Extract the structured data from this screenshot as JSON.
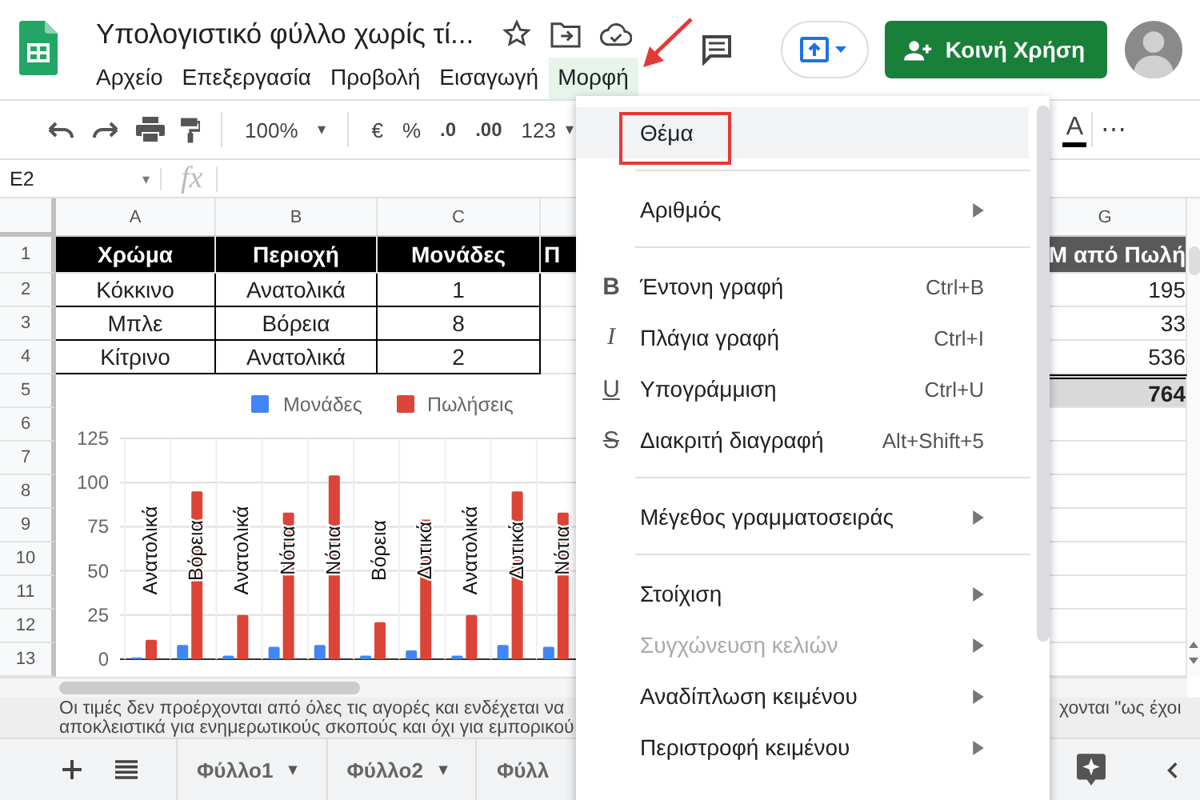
{
  "app": {
    "title": "Υπολογιστικό φύλλο χωρίς τί...",
    "share_button": "Κοινή Χρήση"
  },
  "menus": [
    {
      "label": "Αρχείο",
      "selected": false
    },
    {
      "label": "Επεξεργασία",
      "selected": false
    },
    {
      "label": "Προβολή",
      "selected": false
    },
    {
      "label": "Εισαγωγή",
      "selected": false
    },
    {
      "label": "Μορφή",
      "selected": true
    }
  ],
  "toolbar": {
    "zoom": "100%",
    "zoom_caret": "▾",
    "items": [
      {
        "label": "€",
        "kind": "plain"
      },
      {
        "label": "%",
        "kind": "plain"
      },
      {
        "label": ".0",
        "kind": "decimal"
      },
      {
        "label": ".00",
        "kind": "decimal"
      },
      {
        "label": "123",
        "kind": "dropdown",
        "caret": "▾"
      }
    ],
    "text_color": "A",
    "more": "⋯"
  },
  "formula_bar": {
    "cell_ref": "E2",
    "caret": "▾",
    "fx": "fx"
  },
  "sheet": {
    "columns": [
      "A",
      "B",
      "C",
      "G"
    ],
    "rows": [
      {
        "number": "1",
        "kind": "header",
        "cells": [
          "Χρώμα",
          "Περιοχή",
          "Μονάδες",
          "Π"
        ],
        "g": "M από Πωλή"
      },
      {
        "number": "2",
        "kind": "data",
        "cells": [
          "Κόκκινο",
          "Ανατολικά",
          "1"
        ],
        "g": "195"
      },
      {
        "number": "3",
        "kind": "data",
        "cells": [
          "Μπλε",
          "Βόρεια",
          "8"
        ],
        "g": "33"
      },
      {
        "number": "4",
        "kind": "data",
        "cells": [
          "Κίτρινο",
          "Ανατολικά",
          "2"
        ],
        "g": "536"
      },
      {
        "number": "5",
        "kind": "total",
        "g": "764"
      },
      {
        "number": "6",
        "kind": "blank"
      },
      {
        "number": "7",
        "kind": "blank"
      },
      {
        "number": "8",
        "kind": "blank"
      },
      {
        "number": "9",
        "kind": "blank"
      },
      {
        "number": "10",
        "kind": "blank"
      },
      {
        "number": "11",
        "kind": "blank"
      },
      {
        "number": "12",
        "kind": "blank"
      },
      {
        "number": "13",
        "kind": "blank"
      }
    ]
  },
  "chart": {
    "chart_data": {
      "type": "bar",
      "categories": [
        "Ανατολικά",
        "Βόρεια",
        "Ανατολικά",
        "Νότια",
        "Νότια",
        "Βόρεια",
        "Δυτικά",
        "Ανατολικά",
        "Δυτικά",
        "Νότια"
      ],
      "series": [
        {
          "name": "Μονάδες",
          "color": "#4285f4",
          "values": [
            1,
            8,
            2,
            7,
            8,
            2,
            5,
            2,
            8,
            7
          ]
        },
        {
          "name": "Πωλήσεις",
          "color": "#db4437",
          "values": [
            11,
            95,
            25,
            83,
            104,
            21,
            79,
            25,
            95,
            83
          ]
        }
      ],
      "ylim": [
        0,
        125
      ],
      "yticks": [
        0,
        25,
        50,
        75,
        100,
        125
      ],
      "grid": true,
      "legend": true
    }
  },
  "note": {
    "text": "Οι τιμές δεν προέρχονται από όλες τις αγορές και ενδέχεται να αποκλειστικά για ενημερωτικούς σκοπούς και όχι για εμπορικού",
    "right_fragment": "χονται \"ως έχοι"
  },
  "sheet_tabs": [
    {
      "label": "Φύλλο1",
      "caret": "▾"
    },
    {
      "label": "Φύλλο2",
      "caret": "▾"
    },
    {
      "label": "Φύλλ"
    }
  ],
  "format_menu": {
    "groups": [
      [
        {
          "label": "Θέμα",
          "kind": "plain",
          "submenu": false,
          "disabled": false,
          "selected": true
        }
      ],
      [
        {
          "label": "Αριθμός",
          "kind": "plain",
          "submenu": true,
          "disabled": false,
          "selected": false
        }
      ],
      [
        {
          "label": "Έντονη γραφή",
          "kind": "bold",
          "icon": "B",
          "shortcut": "Ctrl+B",
          "submenu": false,
          "disabled": false,
          "selected": false
        },
        {
          "label": "Πλάγια γραφή",
          "kind": "italic",
          "icon": "I",
          "shortcut": "Ctrl+I",
          "submenu": false,
          "disabled": false,
          "selected": false
        },
        {
          "label": "Υπογράμμιση",
          "kind": "underline",
          "icon": "U",
          "shortcut": "Ctrl+U",
          "submenu": false,
          "disabled": false,
          "selected": false
        },
        {
          "label": "Διακριτή διαγραφή",
          "kind": "strikethrough",
          "icon": "S",
          "shortcut": "Alt+Shift+5",
          "submenu": false,
          "disabled": false,
          "selected": false
        }
      ],
      [
        {
          "label": "Μέγεθος γραμματοσειράς",
          "kind": "plain",
          "submenu": true,
          "disabled": false,
          "selected": false
        }
      ],
      [
        {
          "label": "Στοίχιση",
          "kind": "plain",
          "submenu": true,
          "disabled": false,
          "selected": false
        },
        {
          "label": "Συγχώνευση κελιών",
          "kind": "plain",
          "submenu": true,
          "disabled": true,
          "selected": false
        },
        {
          "label": "Αναδίπλωση κειμένου",
          "kind": "plain",
          "submenu": true,
          "disabled": false,
          "selected": false
        },
        {
          "label": "Περιστροφή κειμένου",
          "kind": "plain",
          "submenu": true,
          "disabled": false,
          "selected": false
        }
      ]
    ]
  }
}
